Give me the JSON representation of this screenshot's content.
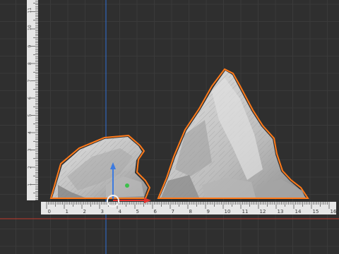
{
  "scene": {
    "colors": {
      "background": "#2f2f2f",
      "grid": "#3a3a3a",
      "ruler": "#e6e6e6",
      "ruler_tick": "#2a2a2a",
      "axis_x": "#c0392b",
      "axis_y": "#2f6fd6",
      "selection": "#ff7a1a",
      "rock_fill": "#cfcfcf",
      "rock_shadow": "#9b9b9b"
    },
    "ruler_horizontal": {
      "unit_labels": [
        "0",
        "1",
        "2",
        "3",
        "4",
        "5",
        "6",
        "7",
        "8",
        "9",
        "10",
        "11",
        "12",
        "13",
        "14",
        "15",
        "16"
      ]
    },
    "ruler_vertical": {
      "unit_labels": [
        "1",
        "2",
        "3",
        "4",
        "5",
        "6",
        "7",
        "8",
        "9",
        "10",
        "11"
      ]
    },
    "objects": [
      {
        "name": "rock-small",
        "selected": true
      },
      {
        "name": "rock-tall",
        "selected": true
      }
    ],
    "gizmo": {
      "icons": [
        "move-arrow-y-icon",
        "move-arrow-x-icon",
        "rotate-ring-icon",
        "pivot-dot-icon"
      ]
    }
  }
}
